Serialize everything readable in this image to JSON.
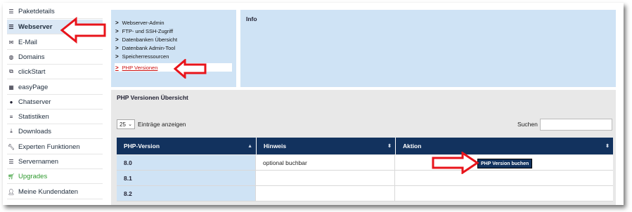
{
  "sidebar": {
    "items": [
      {
        "label": "Paketdetails",
        "icon": "list-icon"
      },
      {
        "label": "Webserver",
        "icon": "server-icon"
      },
      {
        "label": "E-Mail",
        "icon": "envelope-icon"
      },
      {
        "label": "Domains",
        "icon": "globe-icon"
      },
      {
        "label": "clickStart",
        "icon": "cubes-icon"
      },
      {
        "label": "easyPage",
        "icon": "grid-icon"
      },
      {
        "label": "Chatserver",
        "icon": "chat-icon"
      },
      {
        "label": "Statistiken",
        "icon": "bars-icon"
      },
      {
        "label": "Downloads",
        "icon": "download-icon"
      },
      {
        "label": "Experten Funktionen",
        "icon": "wrench-icon"
      },
      {
        "label": "Servernamen",
        "icon": "server-list-icon"
      },
      {
        "label": "Upgrades",
        "icon": "cart-icon"
      },
      {
        "label": "Meine Kundendaten",
        "icon": "user-icon"
      }
    ]
  },
  "menu": {
    "items": [
      "Webserver-Admin",
      "FTP- und SSH-Zugriff",
      "Datenbanken Übersicht",
      "Datenbank Admin-Tool",
      "Speicherressourcen",
      "PHP Versionen"
    ]
  },
  "info": {
    "title": "Info"
  },
  "section": {
    "title": "PHP Versionen Übersicht",
    "entries_value": "25",
    "entries_label": "Einträge anzeigen",
    "search_label": "Suchen",
    "search_value": ""
  },
  "table": {
    "headers": [
      "PHP-Version",
      "Hinweis",
      "Aktion"
    ],
    "rows": [
      {
        "version": "8.0",
        "hint": "optional buchbar",
        "action": "PHP Version buchen"
      },
      {
        "version": "8.1",
        "hint": "",
        "action": ""
      },
      {
        "version": "8.2",
        "hint": "",
        "action": ""
      }
    ]
  },
  "colors": {
    "accent_dark": "#12325e",
    "panel_blue": "#cfe3f5",
    "active_red": "#cc1111",
    "annotation_red": "#e8141b",
    "upgrade_green": "#2f9a2f"
  }
}
